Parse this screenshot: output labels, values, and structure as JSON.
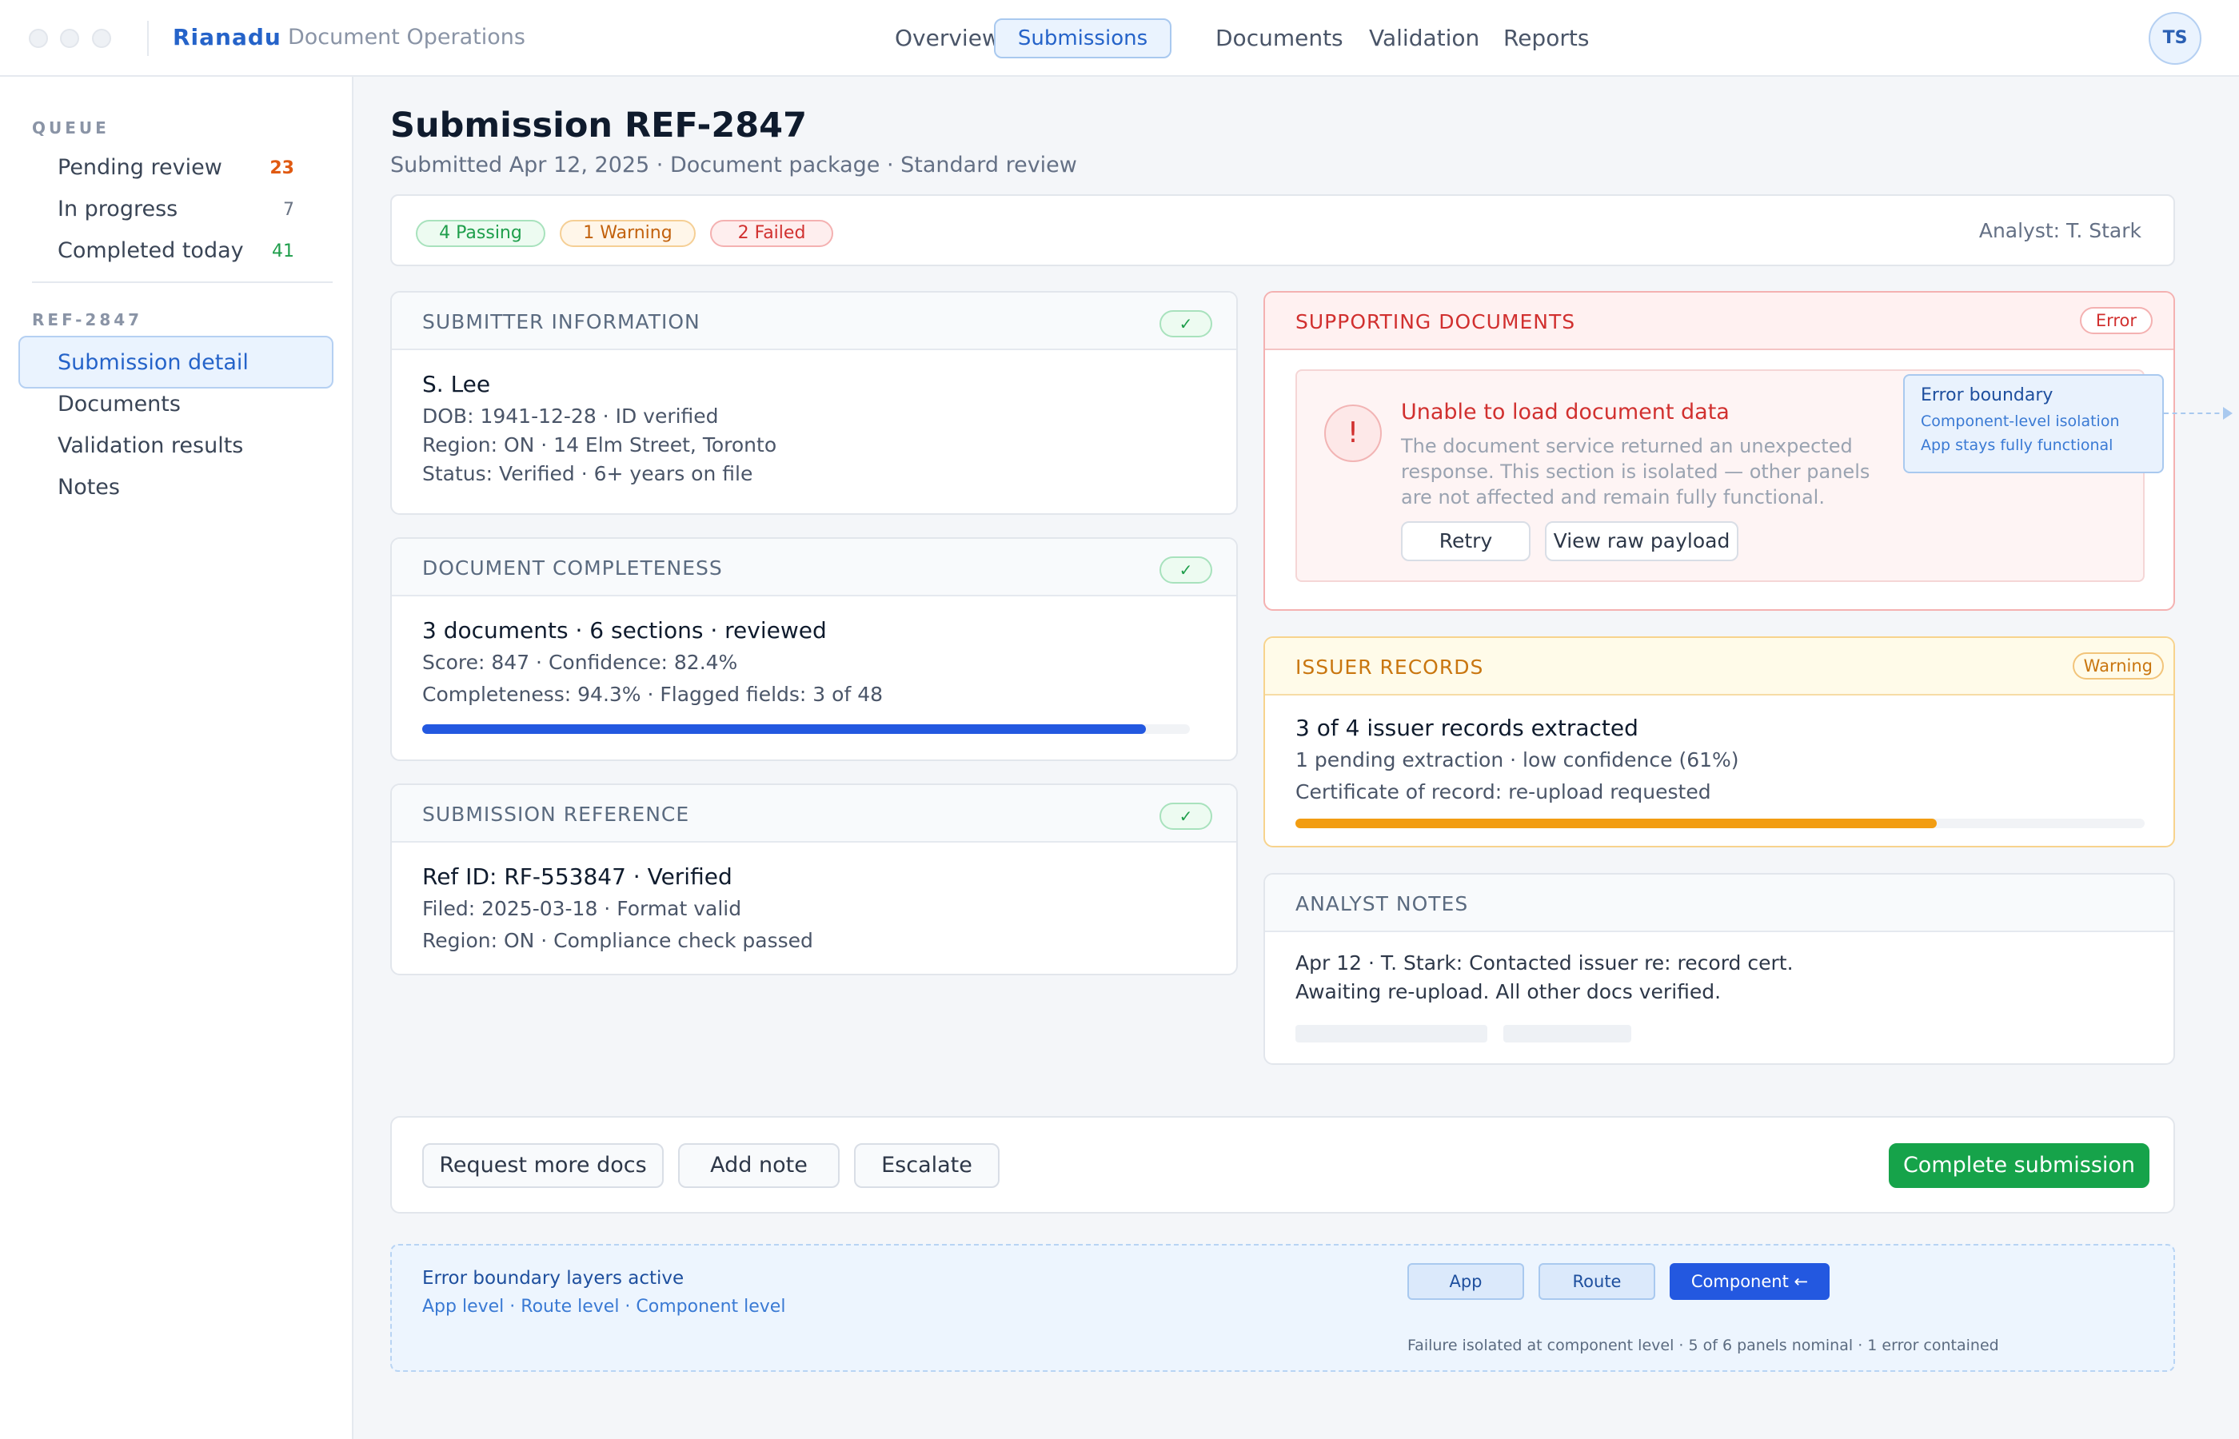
{
  "header": {
    "brand": "Rianadu",
    "product": "Document Operations",
    "nav": [
      "Overview",
      "Submissions",
      "Documents",
      "Validation",
      "Reports"
    ],
    "active_nav": "Submissions",
    "avatar_initials": "TS"
  },
  "sidebar": {
    "queue_heading": "QUEUE",
    "queue_items": [
      {
        "label": "Pending review",
        "count": "23",
        "color": "#e05a12"
      },
      {
        "label": "In progress",
        "count": "7",
        "color": "#6b7585"
      },
      {
        "label": "Completed today",
        "count": "41",
        "color": "#1e9e4b"
      }
    ],
    "ref_heading": "REF-2847",
    "ref_items": [
      "Submission detail",
      "Documents",
      "Validation results",
      "Notes"
    ],
    "active_item": "Submission detail"
  },
  "page": {
    "title": "Submission REF-2847",
    "subtitle": "Submitted Apr 12, 2025 · Document package · Standard review"
  },
  "summary": {
    "passing": "4 Passing",
    "warning": "1 Warning",
    "failed": "2 Failed",
    "analyst": "Analyst: T. Stark"
  },
  "cards": {
    "submitter": {
      "title": "SUBMITTER INFORMATION",
      "check": "✓",
      "name": "S. Lee",
      "lines": [
        "DOB: 1941-12-28 · ID verified",
        "Region: ON · 14 Elm Street, Toronto",
        "Status: Verified · 6+ years on file"
      ]
    },
    "completeness": {
      "title": "DOCUMENT COMPLETENESS",
      "check": "✓",
      "headline": "3 documents · 6 sections · reviewed",
      "lines": [
        "Score: 847 · Confidence: 82.4%",
        "Completeness: 94.3% · Flagged fields: 3 of 48"
      ],
      "progress": 0.943,
      "bar_color": "#2358e0"
    },
    "reference": {
      "title": "SUBMISSION REFERENCE",
      "check": "✓",
      "headline": "Ref ID: RF-553847 · Verified",
      "lines": [
        "Filed: 2025-03-18 · Format valid",
        "Region: ON · Compliance check passed"
      ]
    },
    "supporting": {
      "title": "SUPPORTING DOCUMENTS",
      "badge": "Error",
      "error_icon": "!",
      "error_title": "Unable to load document data",
      "error_lines": [
        "The document service returned an unexpected",
        "response. This section is isolated — other panels",
        "are not affected and remain fully functional."
      ],
      "retry": "Retry",
      "raw": "View raw payload",
      "callout_title": "Error boundary",
      "callout_lines": [
        "Component-level isolation",
        "App stays fully functional"
      ]
    },
    "issuer": {
      "title": "ISSUER RECORDS",
      "badge": "Warning",
      "headline": "3 of 4 issuer records extracted",
      "lines": [
        "1 pending extraction · low confidence (61%)",
        "Certificate of record: re-upload requested"
      ],
      "progress": 0.755,
      "bar_color": "#f29d12"
    },
    "notes": {
      "title": "ANALYST NOTES",
      "lines": [
        "Apr 12 · T. Stark: Contacted issuer re: record cert.",
        "Awaiting re-upload. All other docs verified."
      ]
    }
  },
  "actions": {
    "request": "Request more docs",
    "add_note": "Add note",
    "escalate": "Escalate",
    "complete": "Complete submission"
  },
  "boundary": {
    "title": "Error boundary layers active",
    "levels": "App level · Route level · Component level",
    "buttons": [
      "App",
      "Route",
      "Component ←"
    ],
    "status": "Failure isolated at component level · 5 of 6 panels nominal · 1 error contained"
  }
}
